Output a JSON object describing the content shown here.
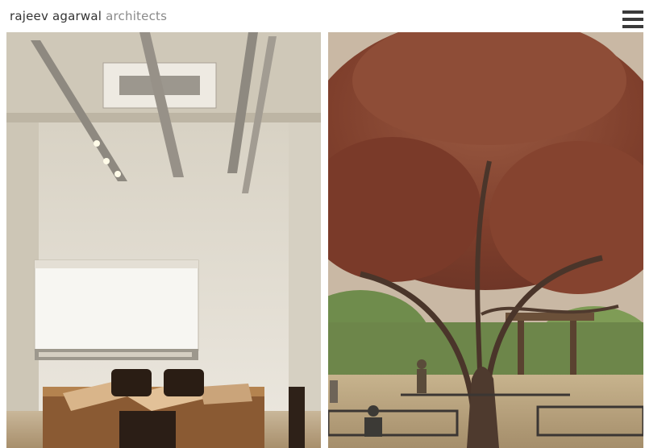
{
  "header": {
    "logo_name": "rajeev agarwal",
    "logo_suffix": " architects"
  },
  "menu": {
    "icon": "hamburger-menu-icon"
  },
  "gallery": {
    "items": [
      {
        "image": "gallery-interior-image"
      },
      {
        "image": "tree-courtyard-image"
      }
    ]
  },
  "colors": {
    "logo_name": "#333333",
    "logo_suffix": "#8a8a8a",
    "menu_icon": "#3a3a3a",
    "gallery_wall": "#e7e3da",
    "tree_foliage": "#8c4a35"
  }
}
